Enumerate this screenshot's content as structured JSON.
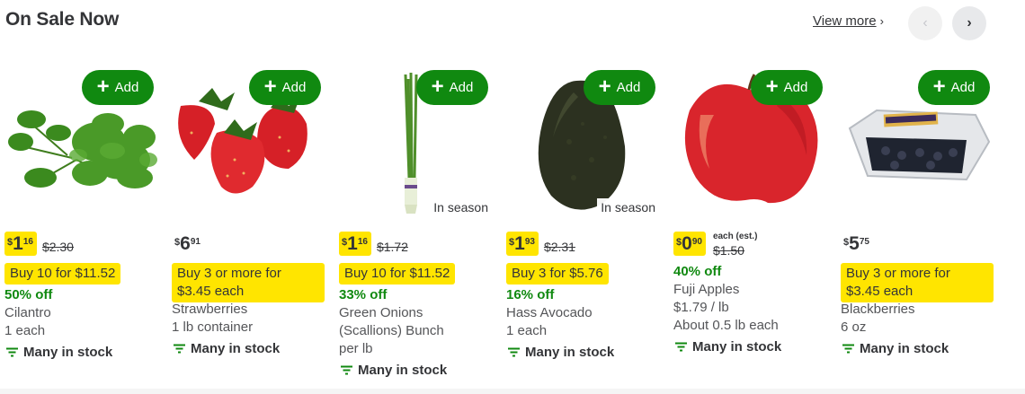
{
  "section": {
    "title": "On Sale Now",
    "view_more": "View more",
    "view_more_chevron": "›",
    "prev_icon": "‹",
    "next_icon": "›"
  },
  "colors": {
    "accent_green": "#108910",
    "promo_yellow": "#ffe500",
    "text": "#343538"
  },
  "add_label": "Add",
  "stock_icon": "filter-lines-icon",
  "products": [
    {
      "name": "Cilantro",
      "image": "cilantro-image",
      "badge": "",
      "price_cur": "$",
      "price_dollars": "1",
      "price_cents": "16",
      "price_sale": true,
      "was_price": "$2.30",
      "promo": "Buy 10 for $11.52",
      "discount": "50% off",
      "unit": "1 each",
      "stock": "Many in stock"
    },
    {
      "name": "Strawberries",
      "image": "strawberries-image",
      "badge": "",
      "price_cur": "$",
      "price_dollars": "6",
      "price_cents": "91",
      "price_sale": false,
      "was_price": "",
      "promo_line1": "Buy 3 or more for",
      "promo_line2": "$3.45 each",
      "unit": "1 lb container",
      "stock": "Many in stock"
    },
    {
      "name_line1": "Green Onions",
      "name_line2": "(Scallions) Bunch",
      "image": "green-onions-image",
      "badge": "In season",
      "price_cur": "$",
      "price_dollars": "1",
      "price_cents": "16",
      "price_sale": true,
      "was_price": "$1.72",
      "promo": "Buy 10 for $11.52",
      "discount": "33% off",
      "unit": "per lb",
      "stock": "Many in stock"
    },
    {
      "name": "Hass Avocado",
      "image": "avocado-image",
      "badge": "In season",
      "price_cur": "$",
      "price_dollars": "1",
      "price_cents": "93",
      "price_sale": true,
      "was_price": "$2.31",
      "promo": "Buy 3 for $5.76",
      "discount": "16% off",
      "unit": "1 each",
      "stock": "Many in stock"
    },
    {
      "name": "Fuji Apples",
      "image": "fuji-apple-image",
      "badge": "",
      "price_cur": "$",
      "price_dollars": "0",
      "price_cents": "90",
      "price_sale": true,
      "price_note": "each (est.)",
      "was_price": "$1.50",
      "discount": "40% off",
      "unit": "$1.79 / lb",
      "unit2": "About 0.5 lb each",
      "stock": "Many in stock"
    },
    {
      "name": "Blackberries",
      "image": "blackberries-image",
      "badge": "",
      "price_cur": "$",
      "price_dollars": "5",
      "price_cents": "75",
      "price_sale": false,
      "was_price": "",
      "promo_line1": "Buy 3 or more for",
      "promo_line2": "$3.45 each",
      "unit": "6 oz",
      "stock": "Many in stock"
    }
  ]
}
